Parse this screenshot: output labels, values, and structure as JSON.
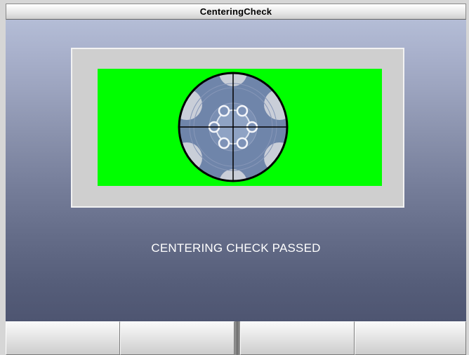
{
  "window": {
    "title": "CenteringCheck"
  },
  "status": {
    "message": "CENTERING CHECK PASSED",
    "indicator_color": "#00ff00"
  },
  "target": {
    "icon": "wheel-rim-crosshair-icon"
  },
  "function_buttons": [
    {
      "label": ""
    },
    {
      "label": ""
    },
    {
      "label": ""
    },
    {
      "label": ""
    }
  ]
}
